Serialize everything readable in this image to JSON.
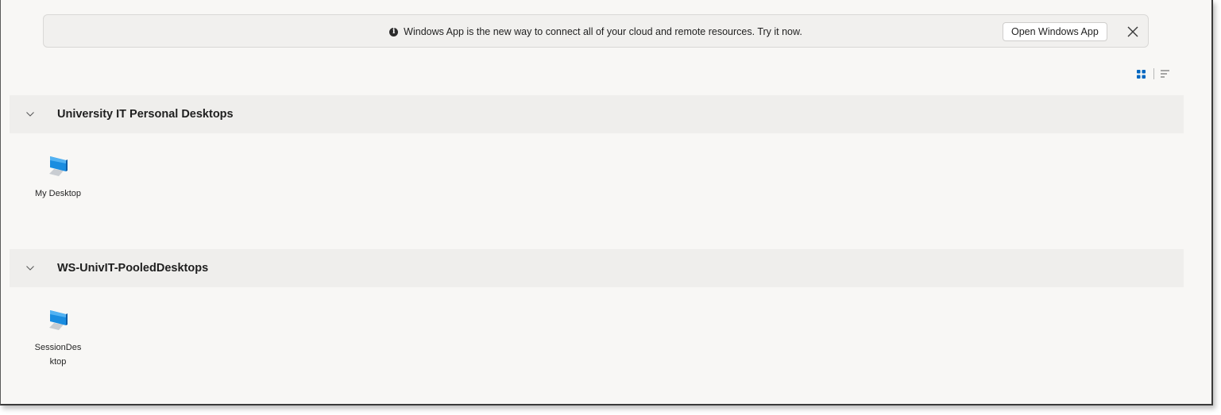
{
  "banner": {
    "message": "Windows App is the new way to connect all of your cloud and remote resources. Try it now.",
    "icon": "info-icon",
    "open_button_label": "Open Windows App",
    "close_icon": "close-icon"
  },
  "view_toggle": {
    "selected": "tile-view",
    "options": [
      "tile-view",
      "list-view"
    ],
    "accent_color": "#0067c0"
  },
  "groups": [
    {
      "title": "University IT Personal Desktops",
      "expanded": true,
      "resources": [
        {
          "label": "My Desktop",
          "icon": "desktop-monitor-icon"
        }
      ]
    },
    {
      "title": "WS-UnivIT-PooledDesktops",
      "expanded": true,
      "resources": [
        {
          "label_line1": "SessionDes",
          "label_line2": "ktop",
          "icon": "desktop-monitor-icon"
        }
      ]
    }
  ]
}
